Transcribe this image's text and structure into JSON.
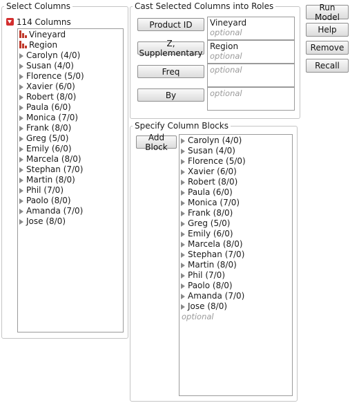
{
  "select_columns": {
    "title": "Select Columns",
    "count_label": "114 Columns",
    "columns": [
      {
        "label": "Vineyard",
        "kind": "nominal"
      },
      {
        "label": "Region",
        "kind": "nominal"
      },
      {
        "label": "Carolyn (4/0)",
        "kind": "group"
      },
      {
        "label": "Susan (4/0)",
        "kind": "group"
      },
      {
        "label": "Florence (5/0)",
        "kind": "group"
      },
      {
        "label": "Xavier (6/0)",
        "kind": "group"
      },
      {
        "label": "Robert (8/0)",
        "kind": "group"
      },
      {
        "label": "Paula (6/0)",
        "kind": "group"
      },
      {
        "label": "Monica (7/0)",
        "kind": "group"
      },
      {
        "label": "Frank (8/0)",
        "kind": "group"
      },
      {
        "label": "Greg (5/0)",
        "kind": "group"
      },
      {
        "label": "Emily (6/0)",
        "kind": "group"
      },
      {
        "label": "Marcela (8/0)",
        "kind": "group"
      },
      {
        "label": "Stephan (7/0)",
        "kind": "group"
      },
      {
        "label": "Martin (8/0)",
        "kind": "group"
      },
      {
        "label": "Phil (7/0)",
        "kind": "group"
      },
      {
        "label": "Paolo (8/0)",
        "kind": "group"
      },
      {
        "label": "Amanda (7/0)",
        "kind": "group"
      },
      {
        "label": "Jose (8/0)",
        "kind": "group"
      }
    ]
  },
  "cast_roles": {
    "title": "Cast Selected Columns into Roles",
    "roles": [
      {
        "button": "Product ID",
        "value": "Vineyard",
        "placeholder": "optional"
      },
      {
        "button": "Z, Supplementary",
        "value": "Region",
        "placeholder": "optional"
      },
      {
        "button": "Freq",
        "value": "",
        "placeholder": "optional"
      },
      {
        "button": "By",
        "value": "",
        "placeholder": "optional"
      }
    ]
  },
  "actions": {
    "run_model": "Run Model",
    "help": "Help",
    "remove": "Remove",
    "recall": "Recall"
  },
  "column_blocks": {
    "title": "Specify Column Blocks",
    "add_block": "Add Block",
    "items": [
      "Carolyn (4/0)",
      "Susan (4/0)",
      "Florence (5/0)",
      "Xavier (6/0)",
      "Robert (8/0)",
      "Paula (6/0)",
      "Monica (7/0)",
      "Frank (8/0)",
      "Greg (5/0)",
      "Emily (6/0)",
      "Marcela (8/0)",
      "Stephan (7/0)",
      "Martin (8/0)",
      "Phil (7/0)",
      "Paolo (8/0)",
      "Amanda (7/0)",
      "Jose (8/0)"
    ],
    "placeholder": "optional"
  },
  "colors": {
    "nominal_icon": "#c0392b",
    "disclosure_red": "#d32f2f",
    "triangle_gray": "#8a8a8a"
  }
}
